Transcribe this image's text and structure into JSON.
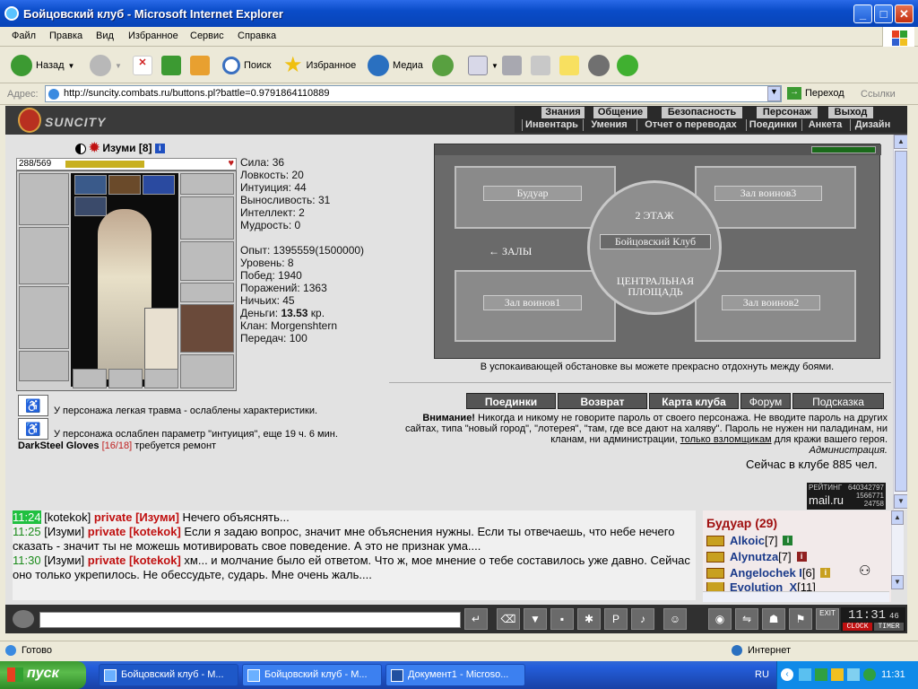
{
  "window": {
    "title": "Бойцовский клуб - Microsoft Internet Explorer"
  },
  "menu": [
    "Файл",
    "Правка",
    "Вид",
    "Избранное",
    "Сервис",
    "Справка"
  ],
  "toolbar": {
    "back": "Назад",
    "search": "Поиск",
    "favorites": "Избранное",
    "media": "Медиа"
  },
  "address": {
    "label": "Адрес:",
    "url": "http://suncity.combats.ru/buttons.pl?battle=0.9791864110889",
    "go": "Переход",
    "links": "Ссылки"
  },
  "site": {
    "logo": "SUNCITY",
    "nav_top": [
      "Знания",
      "Общение",
      "Безопасность",
      "Персонаж",
      "Выход"
    ],
    "nav_bottom": [
      "Инвентарь",
      "Умения",
      "Отчет о переводах",
      "Поединки",
      "Анкета",
      "Дизайн"
    ]
  },
  "character": {
    "name": "Изуми [8]",
    "hp": "288/569",
    "hp_fraction": 0.506,
    "stats": [
      "Сила: 36",
      "Ловкость: 20",
      "Интуиция: 44",
      "Выносливость: 31",
      "Интеллект: 2",
      "Мудрость: 0"
    ],
    "info": [
      "Опыт: 1395559(1500000)",
      "Уровень: 8",
      "Побед: 1940",
      "Поражений: 1363",
      "Ничьих: 45"
    ],
    "money_label": "Деньги: ",
    "money_value": "13.53",
    "money_unit": " кр.",
    "info2": [
      "Клан: Morgenshtern",
      "Передач: 100"
    ],
    "traumas": [
      "У персонажа легкая травма - ослаблены характеристики.",
      "У персонажа ослаблен параметр \"интуиция\", еще 19 ч. 6 мин."
    ],
    "repair_item": "DarkSteel Gloves",
    "repair_count": "[16/18]",
    "repair_text": " требуется ремонт"
  },
  "map": {
    "rooms": [
      "Будуар",
      "Зал воинов3",
      "2 ЭТАЖ",
      "Бойцовский Клуб",
      "← ЗАЛЫ",
      "ЦЕНТРАЛЬНАЯ ПЛОЩАДЬ",
      "Зал воинов1",
      "Зал воинов2"
    ],
    "caption": "В успокаивающей обстановке вы можете прекрасно отдохнуть между боями."
  },
  "buttons": [
    "Поединки",
    "Возврат",
    "Карта клуба",
    "Форум",
    "Подсказка"
  ],
  "warning": {
    "label": "Внимание!",
    "text": " Никогда и никому не говорите пароль от своего персонажа. Не вводите пароль на других сайтах, типа \"новый город\", \"лотерея\", \"там, где все дают на халяву\". Пароль не нужен ни паладинам, ни кланам, ни администрации, ",
    "link": "только взломщикам",
    "tail": " для кражи вашего героя.",
    "sign": "Администрация."
  },
  "online": "Сейчас в клубе 885 чел.",
  "rating": {
    "title": "РЕЙТИНГ",
    "n1": "640342797",
    "n2": "1566771",
    "n3": "24758",
    "brand": "mail.ru"
  },
  "chat": [
    {
      "time": "11:24",
      "from": "[kotekok]",
      "priv": "private [Изуми]",
      "msg": " Нечего объяснять..."
    },
    {
      "time": "11:25",
      "from": "[Изуми]",
      "priv": "private [kotekok]",
      "msg": " Если я задаю вопрос, значит мне объяснения нужны. Если ты отвечаешь, что небе нечего сказать - значит ты не можешь мотивировать свое поведение. А это не признак ума...."
    },
    {
      "time": "11:30",
      "from": "[Изуми]",
      "priv": "private [kotekok]",
      "msg": " хм... и молчание было ей ответом. Что ж, мое мнение о тебе составилось уже давно. Сейчас оно только укрепилось. Не обессудьте, сударь. Мне очень жаль...."
    }
  ],
  "room": {
    "title": "Будуар (29)",
    "users": [
      {
        "name": "Alkoic",
        "lvl": "[7]"
      },
      {
        "name": "Alynutza",
        "lvl": "[7]"
      },
      {
        "name": "Angelochek I",
        "lvl": "[6]"
      },
      {
        "name": "Evolution_X",
        "lvl": "[11]"
      }
    ]
  },
  "clock": {
    "time": "11:31",
    "sec": "46",
    "clock_label": "CLOCK",
    "timer_label": "TIMER",
    "exit": "EXIT"
  },
  "status": {
    "text": "Готово",
    "zone": "Интернет"
  },
  "taskbar": {
    "start": "пуск",
    "tasks": [
      "Бойцовский клуб - М...",
      "Бойцовский клуб - М...",
      "Документ1 - Microso..."
    ],
    "lang": "RU",
    "time": "11:31"
  }
}
